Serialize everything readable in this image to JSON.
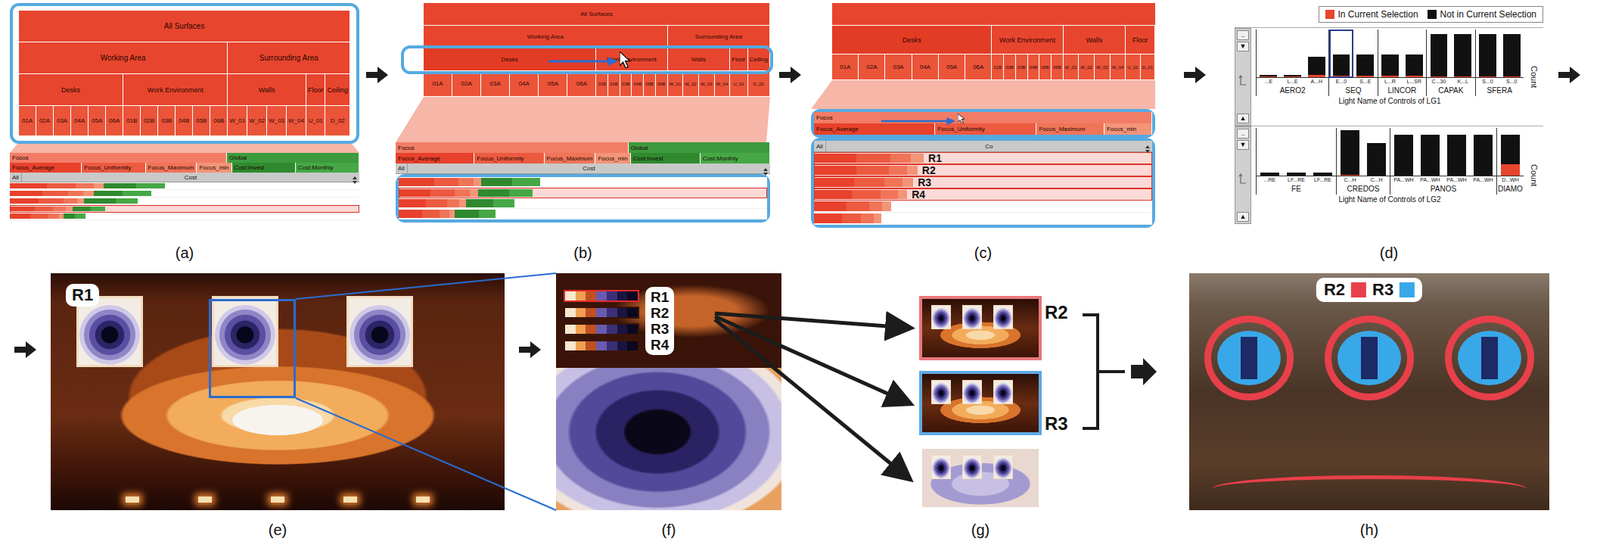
{
  "top_panels": [
    {
      "caption": "(a)",
      "tree": [
        {
          "label": "All Surfaces",
          "expanded": false,
          "children": [
            {
              "label": "Working Area",
              "expanded": false,
              "children": [
                {
                  "label": "Desks",
                  "expanded": false,
                  "leaves": [
                    "01A",
                    "02A",
                    "03A",
                    "04A",
                    "05A",
                    "06A"
                  ]
                },
                {
                  "label": "Work Environment",
                  "expanded": false,
                  "leaves": [
                    "01B",
                    "02B",
                    "03B",
                    "04B",
                    "05B",
                    "06B"
                  ]
                }
              ]
            },
            {
              "label": "Surrounding Area",
              "expanded": false,
              "children": [
                {
                  "label": "Walls",
                  "expanded": false,
                  "leaves": [
                    "W_01",
                    "W_02",
                    "W_03",
                    "W_04"
                  ]
                },
                {
                  "label": "Floor",
                  "expanded": false,
                  "leaves": [
                    "U_01"
                  ]
                },
                {
                  "label": "Ceiling",
                  "expanded": false,
                  "leaves": [
                    "D_02"
                  ]
                }
              ]
            }
          ]
        }
      ],
      "groups": [
        {
          "label": "Focus",
          "color": "#f27c66",
          "columns": [
            {
              "label": "Focus_Average",
              "color": "#e8412c",
              "weight": 0.34
            },
            {
              "label": "Focus_Uniformity",
              "color": "#ec5a40",
              "weight": 0.3
            },
            {
              "label": "Focus_Maximum",
              "color": "#f07458",
              "weight": 0.22
            },
            {
              "label": "Focus_min",
              "color": "#f39478",
              "weight": 0.14
            }
          ]
        },
        {
          "label": "Global",
          "color": "#3d9a3d",
          "columns": [
            {
              "label": "Cost:Invest",
              "color": "#2f8a2f",
              "weight": 0.3
            },
            {
              "label": "Cost:Monthly",
              "color": "#45a845",
              "weight": 0.3
            }
          ]
        }
      ],
      "sort": {
        "all": "All",
        "column": "Cost"
      },
      "rows": [
        {
          "values": [
            0.9,
            0.8,
            0.7,
            0.6,
            0.9,
            0.8
          ],
          "selected": false
        },
        {
          "values": [
            0.8,
            0.7,
            0.6,
            0.6,
            0.8,
            0.8
          ],
          "selected": false
        },
        {
          "values": [
            0.7,
            0.7,
            0.5,
            0.4,
            0.9,
            0.6
          ],
          "selected": false
        },
        {
          "values": [
            0.6,
            0.5,
            0.5,
            0.4,
            0.5,
            0.4
          ],
          "selected": true
        },
        {
          "values": [
            0.5,
            0.5,
            0.4,
            0.3,
            0.3,
            0.3
          ],
          "selected": false
        }
      ]
    },
    {
      "caption": "(b)",
      "tree": [
        {
          "label": "All Surfaces",
          "expanded": false,
          "children": [
            {
              "label": "Working Area",
              "expanded": false,
              "children": [
                {
                  "label": "Desks",
                  "expanded": true,
                  "leaves": [
                    "01A",
                    "02A",
                    "03A",
                    "04A",
                    "05A",
                    "06A"
                  ]
                },
                {
                  "label": "Work Environment",
                  "expanded": false,
                  "leaves": [
                    "01B",
                    "02B",
                    "03B",
                    "04B",
                    "05B",
                    "06B"
                  ]
                }
              ]
            },
            {
              "label": "Surrounding Area",
              "expanded": false,
              "children": [
                {
                  "label": "Walls",
                  "expanded": false,
                  "leaves": [
                    "W_01",
                    "W_02",
                    "W_03",
                    "W_04"
                  ]
                },
                {
                  "label": "Floor",
                  "expanded": false,
                  "leaves": [
                    "U_01"
                  ]
                },
                {
                  "label": "Ceiling",
                  "expanded": false,
                  "leaves": [
                    "D_02"
                  ]
                }
              ]
            }
          ]
        }
      ],
      "groups": [
        {
          "label": "Focus",
          "color": "#f27c66",
          "columns": [
            {
              "label": "Focus_Average",
              "color": "#e8412c",
              "weight": 0.34
            },
            {
              "label": "Focus_Uniformity",
              "color": "#ec5a40",
              "weight": 0.3
            },
            {
              "label": "Focus_Maximum",
              "color": "#f07458",
              "weight": 0.22
            },
            {
              "label": "Focus_min",
              "color": "#f39478",
              "weight": 0.14
            }
          ]
        },
        {
          "label": "Global",
          "color": "#3d9a3d",
          "columns": [
            {
              "label": "Cost:Invest",
              "color": "#2f8a2f",
              "weight": 0.3
            },
            {
              "label": "Cost:Monthly",
              "color": "#45a845",
              "weight": 0.3
            }
          ]
        }
      ],
      "sort": {
        "all": "All",
        "column": "Cost"
      },
      "rows": [
        {
          "values": [
            0.9,
            0.7,
            0.6,
            0.5,
            0.9,
            0.8
          ],
          "selected": false
        },
        {
          "values": [
            0.8,
            0.7,
            0.6,
            0.5,
            0.9,
            0.7
          ],
          "selected": true
        },
        {
          "values": [
            0.7,
            0.6,
            0.5,
            0.4,
            0.8,
            0.6
          ],
          "selected": false
        },
        {
          "values": [
            0.6,
            0.5,
            0.4,
            0.3,
            0.7,
            0.5
          ],
          "selected": false
        }
      ]
    },
    {
      "caption": "(c)",
      "tree": [
        {
          "label": "Desks",
          "expanded": true,
          "leaves": [
            "01A",
            "02A",
            "03A",
            "04A",
            "05A",
            "06A"
          ]
        },
        {
          "label": "Work Environment",
          "expanded": false,
          "leaves": [
            "01B",
            "02B",
            "03B",
            "04B",
            "05B",
            "06B"
          ]
        },
        {
          "label": "Walls",
          "expanded": false,
          "leaves": [
            "W_01",
            "W_02",
            "W_03",
            "W_04"
          ]
        },
        {
          "label": "Floor",
          "expanded": false,
          "leaves": [
            "U_01",
            "D_01"
          ]
        }
      ],
      "groups": [
        {
          "label": "Focus",
          "color": "#f27c66",
          "columns": [
            {
              "label": "Focus_Average",
              "color": "#e8412c",
              "weight": 0.36
            },
            {
              "label": "Focus_Uniformity",
              "color": "#ec5a40",
              "weight": 0.3
            },
            {
              "label": "Focus_Maximum",
              "color": "#f07458",
              "weight": 0.2
            },
            {
              "label": "Focus_min",
              "color": "#f39478",
              "weight": 0.14
            }
          ]
        }
      ],
      "sort": {
        "all": "All",
        "column": "Co"
      },
      "rows": [
        {
          "values": [
            0.9,
            0.9,
            0.8,
            0.7
          ],
          "selected": true,
          "label": "R1"
        },
        {
          "values": [
            0.9,
            0.85,
            0.7,
            0.6
          ],
          "selected": true,
          "label": "R2"
        },
        {
          "values": [
            0.85,
            0.8,
            0.7,
            0.6
          ],
          "selected": true,
          "label": "R3"
        },
        {
          "values": [
            0.8,
            0.75,
            0.7,
            0.5
          ],
          "selected": true,
          "label": "R4"
        },
        {
          "values": [
            0.7,
            0.6,
            0.5,
            0.5
          ],
          "selected": false
        },
        {
          "values": [
            0.6,
            0.5,
            0.5,
            0.4
          ],
          "selected": false
        }
      ]
    }
  ],
  "histogram_panel": {
    "caption": "(d)",
    "legend": [
      {
        "label": "In Current Selection",
        "color": "#e8452e"
      },
      {
        "label": "Not in Current Selection",
        "color": "#111111"
      }
    ],
    "scroll": {
      "top": "..",
      "down": "▼",
      "up": "▲"
    },
    "charts": [
      {
        "axis_title": "Light Name of Controls of LG1",
        "y_title": "Count",
        "groups": [
          {
            "label": "AERO2",
            "bars": [
              {
                "label": "...E",
                "value": 0.05,
                "selected_value": 0.02,
                "highlighted": false
              },
              {
                "label": "L...E",
                "value": 0.05,
                "selected_value": 0.02,
                "highlighted": false
              },
              {
                "label": "A...H",
                "value": 0.45,
                "selected_value": 0.05,
                "highlighted": false
              }
            ]
          },
          {
            "label": "SEQ",
            "bars": [
              {
                "label": "E...0",
                "value": 0.5,
                "selected_value": 0.04,
                "highlighted": true
              },
              {
                "label": "S...E",
                "value": 0.5,
                "selected_value": 0.03,
                "highlighted": false
              }
            ]
          },
          {
            "label": "LINCOR",
            "bars": [
              {
                "label": "L...R",
                "value": 0.5,
                "selected_value": 0.03,
                "highlighted": false
              },
              {
                "label": "L...SR",
                "value": 0.5,
                "selected_value": 0.03,
                "highlighted": false
              }
            ]
          },
          {
            "label": "CAPAK",
            "bars": [
              {
                "label": "C...30",
                "value": 0.95,
                "selected_value": 0.02,
                "highlighted": false
              },
              {
                "label": "K...L",
                "value": 0.95,
                "selected_value": 0.02,
                "highlighted": false
              }
            ]
          },
          {
            "label": "SFERA",
            "bars": [
              {
                "label": "S...0",
                "value": 0.95,
                "selected_value": 0.02,
                "highlighted": false
              },
              {
                "label": "S...0",
                "value": 0.95,
                "selected_value": 0.02,
                "highlighted": false
              }
            ]
          }
        ]
      },
      {
        "axis_title": "Light Name of Controls of LG2",
        "y_title": "Count",
        "groups": [
          {
            "label": "FE",
            "bars": [
              {
                "label": "...RE",
                "value": 0.06,
                "selected_value": 0,
                "highlighted": false
              },
              {
                "label": "LF...RE",
                "value": 0.06,
                "selected_value": 0,
                "highlighted": false
              },
              {
                "label": "LF...RE",
                "value": 0.06,
                "selected_value": 0,
                "highlighted": false
              }
            ]
          },
          {
            "label": "CREDOS",
            "bars": [
              {
                "label": "C...H",
                "value": 1.0,
                "selected_value": 0.02,
                "highlighted": false
              },
              {
                "label": "C...H",
                "value": 0.72,
                "selected_value": 0,
                "highlighted": false
              }
            ]
          },
          {
            "label": "PANOS",
            "bars": [
              {
                "label": "PA...WH",
                "value": 0.9,
                "selected_value": 0,
                "highlighted": false
              },
              {
                "label": "PA...WH",
                "value": 0.9,
                "selected_value": 0,
                "highlighted": false
              },
              {
                "label": "PA...WH",
                "value": 0.9,
                "selected_value": 0,
                "highlighted": false
              },
              {
                "label": "PA...WH",
                "value": 0.9,
                "selected_value": 0,
                "highlighted": false
              }
            ]
          },
          {
            "label": "DIAMO",
            "bars": [
              {
                "label": "D...WH",
                "value": 0.9,
                "selected_value": 0.25,
                "highlighted": false
              }
            ]
          }
        ]
      }
    ]
  },
  "render_e": {
    "caption": "(e)",
    "badge": "R1"
  },
  "render_f": {
    "caption": "(f)",
    "rows": [
      {
        "label": "R1",
        "selected": true
      },
      {
        "label": "R2",
        "selected": false
      },
      {
        "label": "R3",
        "selected": false
      },
      {
        "label": "R4",
        "selected": false
      }
    ]
  },
  "render_g": {
    "caption": "(g)",
    "images": [
      {
        "color": "#e8787c"
      },
      {
        "color": "#5ea9e4"
      },
      {
        "color": "#ffffff"
      }
    ],
    "labels": [
      "R2",
      "R3"
    ]
  },
  "render_h": {
    "caption": "(h)",
    "legend": [
      {
        "label": "R2",
        "color": "#e8404a"
      },
      {
        "label": "R3",
        "color": "#39a8e8"
      }
    ]
  }
}
